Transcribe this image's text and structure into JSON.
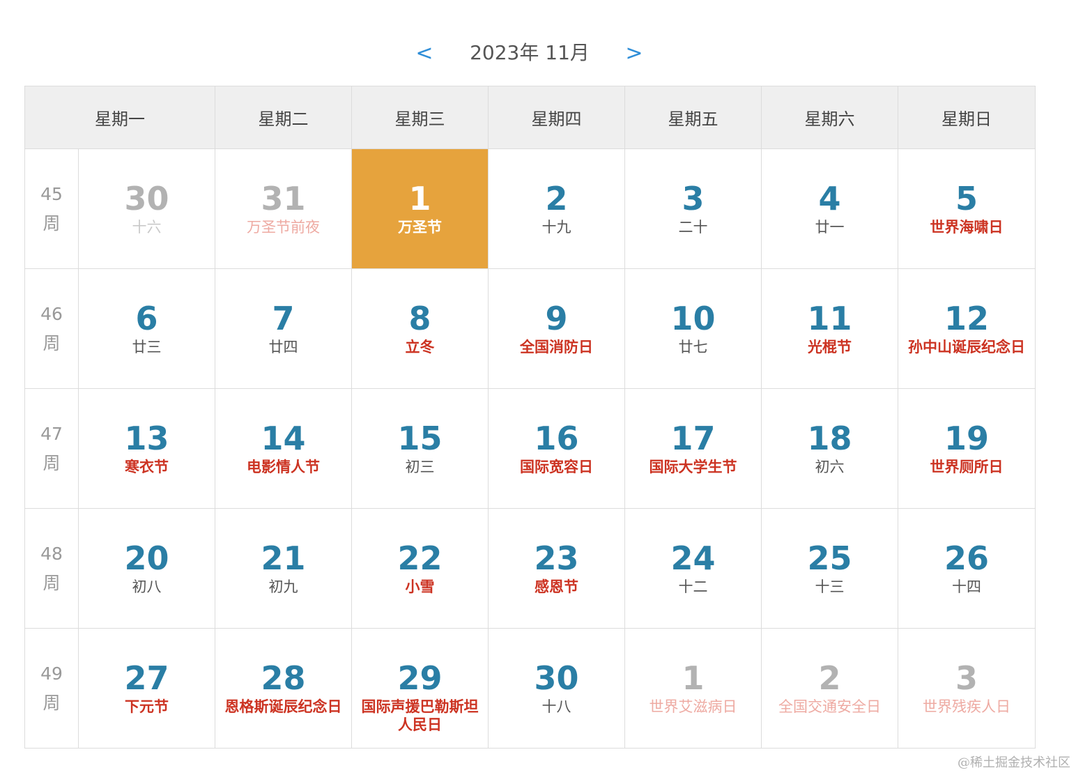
{
  "header": {
    "title": "2023年 11月",
    "prev_label": "<",
    "next_label": ">"
  },
  "weekdays": [
    "星期一",
    "星期二",
    "星期三",
    "星期四",
    "星期五",
    "星期六",
    "星期日"
  ],
  "weeks": [
    {
      "week_num": "45",
      "week_label": "周",
      "days": [
        {
          "day": "30",
          "sub": "十六",
          "festival": false,
          "other_month": true,
          "today": false
        },
        {
          "day": "31",
          "sub": "万圣节前夜",
          "festival": true,
          "other_month": true,
          "today": false
        },
        {
          "day": "1",
          "sub": "万圣节",
          "festival": true,
          "other_month": false,
          "today": true
        },
        {
          "day": "2",
          "sub": "十九",
          "festival": false,
          "other_month": false,
          "today": false
        },
        {
          "day": "3",
          "sub": "二十",
          "festival": false,
          "other_month": false,
          "today": false
        },
        {
          "day": "4",
          "sub": "廿一",
          "festival": false,
          "other_month": false,
          "today": false
        },
        {
          "day": "5",
          "sub": "世界海啸日",
          "festival": true,
          "other_month": false,
          "today": false
        }
      ]
    },
    {
      "week_num": "46",
      "week_label": "周",
      "days": [
        {
          "day": "6",
          "sub": "廿三",
          "festival": false,
          "other_month": false,
          "today": false
        },
        {
          "day": "7",
          "sub": "廿四",
          "festival": false,
          "other_month": false,
          "today": false
        },
        {
          "day": "8",
          "sub": "立冬",
          "festival": true,
          "other_month": false,
          "today": false
        },
        {
          "day": "9",
          "sub": "全国消防日",
          "festival": true,
          "other_month": false,
          "today": false
        },
        {
          "day": "10",
          "sub": "廿七",
          "festival": false,
          "other_month": false,
          "today": false
        },
        {
          "day": "11",
          "sub": "光棍节",
          "festival": true,
          "other_month": false,
          "today": false
        },
        {
          "day": "12",
          "sub": "孙中山诞辰纪念日",
          "festival": true,
          "other_month": false,
          "today": false
        }
      ]
    },
    {
      "week_num": "47",
      "week_label": "周",
      "days": [
        {
          "day": "13",
          "sub": "寒衣节",
          "festival": true,
          "other_month": false,
          "today": false
        },
        {
          "day": "14",
          "sub": "电影情人节",
          "festival": true,
          "other_month": false,
          "today": false
        },
        {
          "day": "15",
          "sub": "初三",
          "festival": false,
          "other_month": false,
          "today": false
        },
        {
          "day": "16",
          "sub": "国际宽容日",
          "festival": true,
          "other_month": false,
          "today": false
        },
        {
          "day": "17",
          "sub": "国际大学生节",
          "festival": true,
          "other_month": false,
          "today": false
        },
        {
          "day": "18",
          "sub": "初六",
          "festival": false,
          "other_month": false,
          "today": false
        },
        {
          "day": "19",
          "sub": "世界厕所日",
          "festival": true,
          "other_month": false,
          "today": false
        }
      ]
    },
    {
      "week_num": "48",
      "week_label": "周",
      "days": [
        {
          "day": "20",
          "sub": "初八",
          "festival": false,
          "other_month": false,
          "today": false
        },
        {
          "day": "21",
          "sub": "初九",
          "festival": false,
          "other_month": false,
          "today": false
        },
        {
          "day": "22",
          "sub": "小雪",
          "festival": true,
          "other_month": false,
          "today": false
        },
        {
          "day": "23",
          "sub": "感恩节",
          "festival": true,
          "other_month": false,
          "today": false
        },
        {
          "day": "24",
          "sub": "十二",
          "festival": false,
          "other_month": false,
          "today": false
        },
        {
          "day": "25",
          "sub": "十三",
          "festival": false,
          "other_month": false,
          "today": false
        },
        {
          "day": "26",
          "sub": "十四",
          "festival": false,
          "other_month": false,
          "today": false
        }
      ]
    },
    {
      "week_num": "49",
      "week_label": "周",
      "days": [
        {
          "day": "27",
          "sub": "下元节",
          "festival": true,
          "other_month": false,
          "today": false
        },
        {
          "day": "28",
          "sub": "恩格斯诞辰纪念日",
          "festival": true,
          "other_month": false,
          "today": false
        },
        {
          "day": "29",
          "sub": "国际声援巴勒斯坦人民日",
          "festival": true,
          "other_month": false,
          "today": false
        },
        {
          "day": "30",
          "sub": "十八",
          "festival": false,
          "other_month": false,
          "today": false
        },
        {
          "day": "1",
          "sub": "世界艾滋病日",
          "festival": true,
          "other_month": true,
          "today": false
        },
        {
          "day": "2",
          "sub": "全国交通安全日",
          "festival": true,
          "other_month": true,
          "today": false
        },
        {
          "day": "3",
          "sub": "世界残疾人日",
          "festival": true,
          "other_month": true,
          "today": false
        }
      ]
    }
  ],
  "watermark": "@稀土掘金技术社区",
  "colors": {
    "accent": "#2f8ed8",
    "day_number": "#2a7ea5",
    "festival": "#cc3322",
    "today_bg": "#e6a33d",
    "header_bg": "#efefef"
  }
}
